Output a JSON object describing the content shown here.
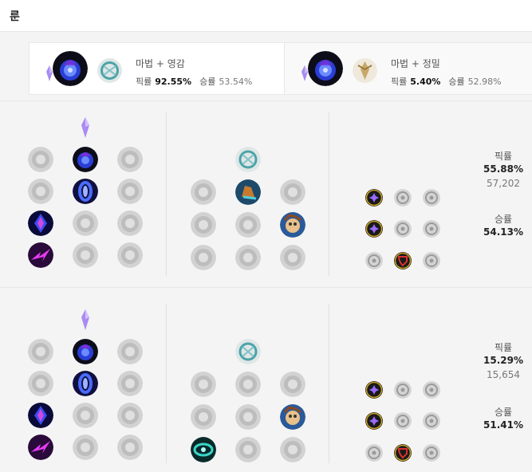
{
  "header": {
    "title": "룬"
  },
  "tabs": [
    {
      "name": "마법 + 영감",
      "pick_label": "픽률",
      "pick": "92.55%",
      "win_label": "승률",
      "win": "53.54%"
    },
    {
      "name": "마법 + 정밀",
      "pick_label": "픽률",
      "pick": "5.40%",
      "win_label": "승률",
      "win": "52.98%"
    }
  ],
  "builds": [
    {
      "pick_label": "픽률",
      "pick": "55.88%",
      "count": "57,202",
      "win_label": "승률",
      "win": "54.13%"
    },
    {
      "pick_label": "픽률",
      "pick": "15.29%",
      "count": "15,654",
      "win_label": "승률",
      "win": "51.41%"
    }
  ],
  "colors": {
    "sorcery_purple": "#8a5cf0",
    "inspiration_teal": "#4aa3a8",
    "precision_gold": "#c8a96a",
    "shard_gold": "#c9a227",
    "shard_red": "#d9322e"
  }
}
